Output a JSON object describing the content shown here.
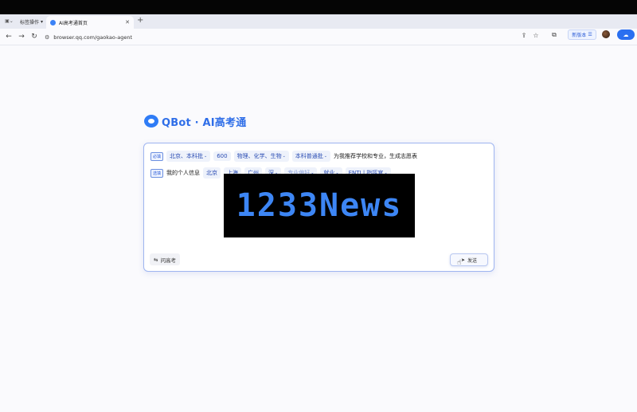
{
  "browser": {
    "tab_group_label": "标签操作",
    "tab_title": "AI高考通首页",
    "url": "browser.qq.com/gaokao-agent",
    "version_btn": "新版本"
  },
  "icons": {
    "sidebar": "sidebar-toggle-icon",
    "back": "back-arrow-icon",
    "forward": "forward-arrow-icon",
    "reload": "reload-icon",
    "site": "site-info-icon",
    "share": "share-icon",
    "star": "star-icon",
    "extensions": "extensions-icon",
    "menu": "menu-icon",
    "cloud": "cloud-icon",
    "send": "send-icon",
    "ask": "swap-icon"
  },
  "logo": {
    "text": "QBot · AI高考通"
  },
  "form": {
    "required_badge": "必填",
    "optional_badge": "选填",
    "row1": {
      "region": "北京、本科批",
      "score": "600",
      "subjects": "物理、化学、生物",
      "batch": "本科普通批",
      "suffix": "为我推荐学校和专业，生成志愿表"
    },
    "row2": {
      "prefix": "我的个人信息",
      "city1": "北京",
      "city2": "上海",
      "city3": "广州",
      "city4": "深",
      "pref": "专业偏好",
      "job": "就业",
      "personality": "ENTJ | 指挥官"
    },
    "ask_btn": "问高考",
    "send_btn": "发送"
  },
  "watermark": {
    "text": "1233News"
  },
  "colors": {
    "accent": "#2f6ee8",
    "chip_bg": "#eef2fb",
    "watermark": "#3d86f5"
  }
}
